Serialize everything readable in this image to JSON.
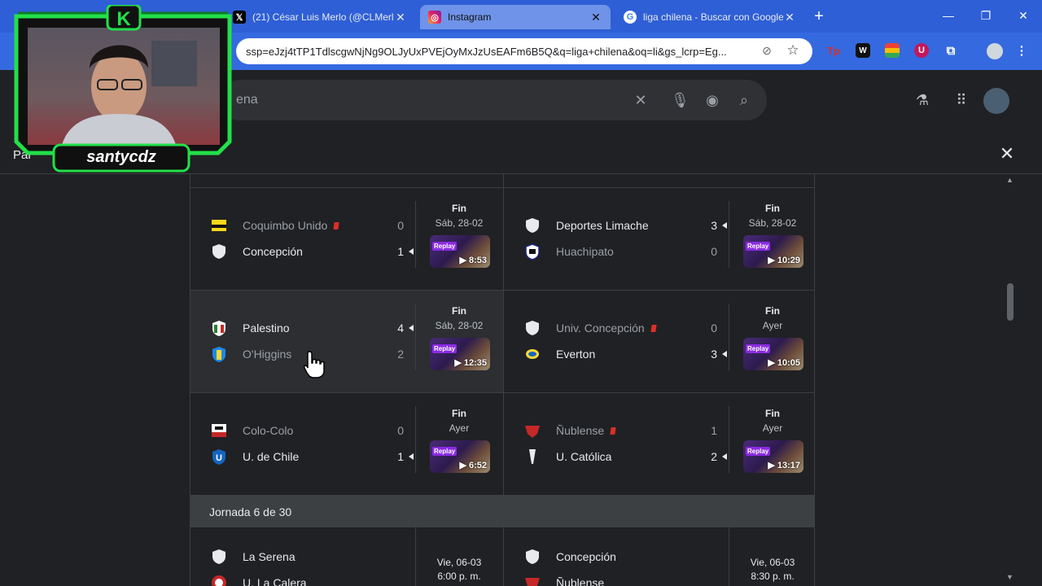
{
  "browser": {
    "tabs": [
      {
        "title": "(21) César Luis Merlo (@CLMerlo)",
        "icon": "x-icon"
      },
      {
        "title": "Instagram",
        "icon": "instagram-icon"
      },
      {
        "title": "liga chilena - Buscar con Google",
        "icon": "google-icon"
      }
    ],
    "new_tab": "+",
    "url": "ssp=eJzj4tTP1TdlscgwNjNg9OLJyUxPVEjOyMxJzUsEAFm6B5Q&q=liga+chilena&oq=li&gs_lcrp=Eg...",
    "window_controls": {
      "minimize": "—",
      "restore": "❐",
      "close": "✕"
    }
  },
  "search": {
    "partial_query": "ena"
  },
  "panel": {
    "title_fragment": "Par",
    "close": "✕"
  },
  "overlay": {
    "streamer": "santycdz",
    "logo_letter": "K"
  },
  "matches": [
    {
      "home": {
        "name": "Coquimbo Unido",
        "score": "0",
        "red_card": true,
        "win": false
      },
      "away": {
        "name": "Concepción",
        "score": "1",
        "red_card": false,
        "win": true
      },
      "status": "Fin",
      "date": "Sáb, 28-02",
      "duration": "8:53"
    },
    {
      "home": {
        "name": "Deportes Limache",
        "score": "3",
        "red_card": false,
        "win": true
      },
      "away": {
        "name": "Huachipato",
        "score": "0",
        "red_card": false,
        "win": false
      },
      "status": "Fin",
      "date": "Sáb, 28-02",
      "duration": "10:29"
    },
    {
      "home": {
        "name": "Palestino",
        "score": "4",
        "red_card": false,
        "win": true
      },
      "away": {
        "name": "O'Higgins",
        "score": "2",
        "red_card": false,
        "win": false
      },
      "status": "Fin",
      "date": "Sáb, 28-02",
      "duration": "12:35"
    },
    {
      "home": {
        "name": "Univ. Concepción",
        "score": "0",
        "red_card": true,
        "win": false
      },
      "away": {
        "name": "Everton",
        "score": "3",
        "red_card": false,
        "win": true
      },
      "status": "Fin",
      "date": "Ayer",
      "duration": "10:05"
    },
    {
      "home": {
        "name": "Colo-Colo",
        "score": "0",
        "red_card": false,
        "win": false
      },
      "away": {
        "name": "U. de Chile",
        "score": "1",
        "red_card": false,
        "win": true
      },
      "status": "Fin",
      "date": "Ayer",
      "duration": "6:52"
    },
    {
      "home": {
        "name": "Ñublense",
        "score": "1",
        "red_card": true,
        "win": false
      },
      "away": {
        "name": "U. Católica",
        "score": "2",
        "red_card": false,
        "win": true
      },
      "status": "Fin",
      "date": "Ayer",
      "duration": "13:17"
    }
  ],
  "replay_label": "Replay",
  "jornada": "Jornada 6 de 30",
  "upcoming": [
    {
      "home": "La Serena",
      "away": "U. La Calera",
      "date": "Vie, 06-03",
      "time": "6:00 p. m."
    },
    {
      "home": "Concepción",
      "away": "Ñublense",
      "date": "Vie, 06-03",
      "time": "8:30 p. m."
    }
  ]
}
